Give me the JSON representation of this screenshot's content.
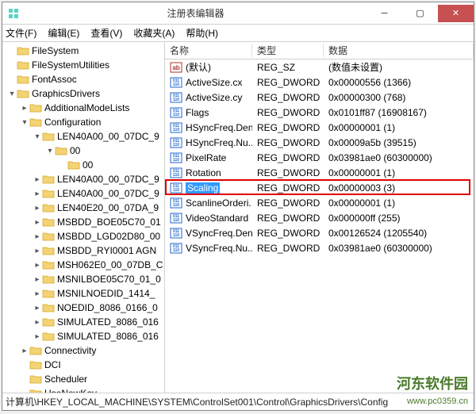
{
  "window": {
    "title": "注册表编辑器"
  },
  "menu": {
    "file": "文件(F)",
    "edit": "编辑(E)",
    "view": "查看(V)",
    "favorites": "收藏夹(A)",
    "help": "帮助(H)"
  },
  "tree": [
    {
      "depth": 0,
      "tw": "",
      "label": "FileSystem"
    },
    {
      "depth": 0,
      "tw": "",
      "label": "FileSystemUtilities"
    },
    {
      "depth": 0,
      "tw": "",
      "label": "FontAssoc"
    },
    {
      "depth": 0,
      "tw": "▾",
      "label": "GraphicsDrivers"
    },
    {
      "depth": 1,
      "tw": "▸",
      "label": "AdditionalModeLists"
    },
    {
      "depth": 1,
      "tw": "▾",
      "label": "Configuration"
    },
    {
      "depth": 2,
      "tw": "▾",
      "label": "LEN40A00_00_07DC_9"
    },
    {
      "depth": 3,
      "tw": "▾",
      "label": "00"
    },
    {
      "depth": 4,
      "tw": "",
      "label": "00"
    },
    {
      "depth": 2,
      "tw": "▸",
      "label": "LEN40A00_00_07DC_9"
    },
    {
      "depth": 2,
      "tw": "▸",
      "label": "LEN40A00_00_07DC_9"
    },
    {
      "depth": 2,
      "tw": "▸",
      "label": "LEN40E20_00_07DA_9"
    },
    {
      "depth": 2,
      "tw": "▸",
      "label": "MSBDD_BOE05C70_01"
    },
    {
      "depth": 2,
      "tw": "▸",
      "label": "MSBDD_LGD02D80_00"
    },
    {
      "depth": 2,
      "tw": "▸",
      "label": "MSBDD_RYI0001 AGN"
    },
    {
      "depth": 2,
      "tw": "▸",
      "label": "MSH062E0_00_07DB_C"
    },
    {
      "depth": 2,
      "tw": "▸",
      "label": "MSNILBOE05C70_01_0"
    },
    {
      "depth": 2,
      "tw": "▸",
      "label": "MSNILNOEDID_1414_"
    },
    {
      "depth": 2,
      "tw": "▸",
      "label": "NOEDID_8086_0166_0"
    },
    {
      "depth": 2,
      "tw": "▸",
      "label": "SIMULATED_8086_016"
    },
    {
      "depth": 2,
      "tw": "▸",
      "label": "SIMULATED_8086_016"
    },
    {
      "depth": 1,
      "tw": "▸",
      "label": "Connectivity"
    },
    {
      "depth": 1,
      "tw": "",
      "label": "DCI"
    },
    {
      "depth": 1,
      "tw": "",
      "label": "Scheduler"
    },
    {
      "depth": 1,
      "tw": "",
      "label": "UseNewKey"
    }
  ],
  "list": {
    "headers": {
      "name": "名称",
      "type": "类型",
      "data": "数据"
    },
    "rows": [
      {
        "icon": "sz",
        "name": "(默认)",
        "type": "REG_SZ",
        "data": "(数值未设置)"
      },
      {
        "icon": "dw",
        "name": "ActiveSize.cx",
        "type": "REG_DWORD",
        "data": "0x00000556 (1366)"
      },
      {
        "icon": "dw",
        "name": "ActiveSize.cy",
        "type": "REG_DWORD",
        "data": "0x00000300 (768)"
      },
      {
        "icon": "dw",
        "name": "Flags",
        "type": "REG_DWORD",
        "data": "0x0101ff87 (16908167)"
      },
      {
        "icon": "dw",
        "name": "HSyncFreq.Den...",
        "type": "REG_DWORD",
        "data": "0x00000001 (1)"
      },
      {
        "icon": "dw",
        "name": "HSyncFreq.Nu...",
        "type": "REG_DWORD",
        "data": "0x00009a5b (39515)"
      },
      {
        "icon": "dw",
        "name": "PixelRate",
        "type": "REG_DWORD",
        "data": "0x03981ae0 (60300000)"
      },
      {
        "icon": "dw",
        "name": "Rotation",
        "type": "REG_DWORD",
        "data": "0x00000001 (1)"
      },
      {
        "icon": "dw",
        "name": "Scaling",
        "type": "REG_DWORD",
        "data": "0x00000003 (3)",
        "selected": true
      },
      {
        "icon": "dw",
        "name": "ScanlineOrderi...",
        "type": "REG_DWORD",
        "data": "0x00000001 (1)"
      },
      {
        "icon": "dw",
        "name": "VideoStandard",
        "type": "REG_DWORD",
        "data": "0x000000ff (255)"
      },
      {
        "icon": "dw",
        "name": "VSyncFreq.Den...",
        "type": "REG_DWORD",
        "data": "0x00126524 (1205540)"
      },
      {
        "icon": "dw",
        "name": "VSyncFreq.Nu...",
        "type": "REG_DWORD",
        "data": "0x03981ae0 (60300000)"
      }
    ]
  },
  "statusbar": "计算机\\HKEY_LOCAL_MACHINE\\SYSTEM\\ControlSet001\\Control\\GraphicsDrivers\\Config",
  "watermark": {
    "text": "河东软件园",
    "url": "www.pc0359.cn"
  }
}
